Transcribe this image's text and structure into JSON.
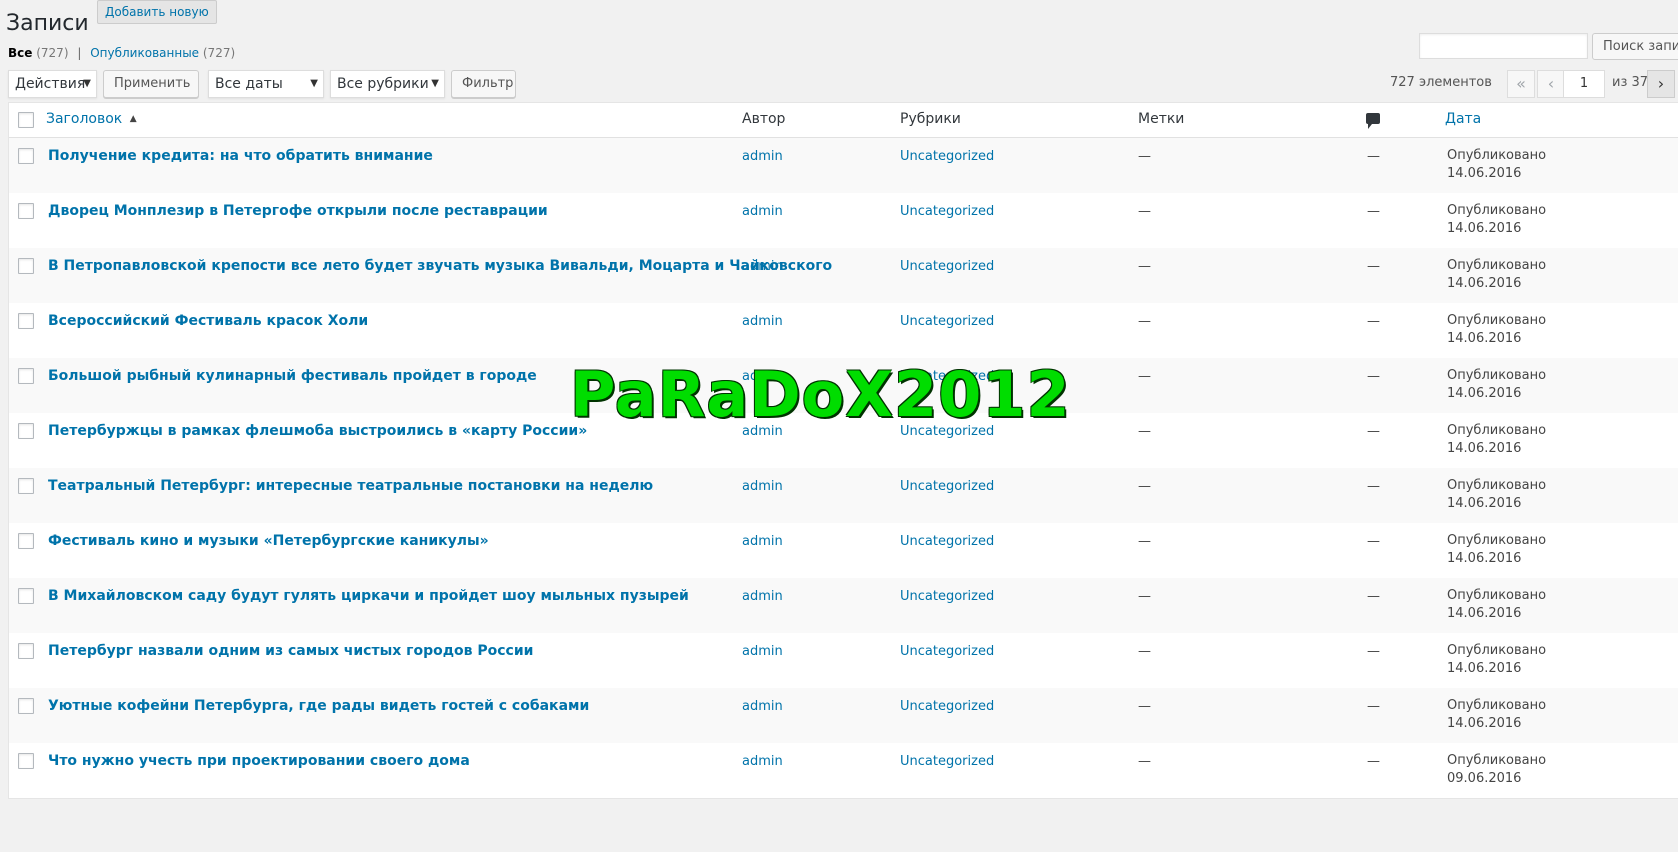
{
  "header": {
    "title": "Записи",
    "add_new": "Добавить новую"
  },
  "views": {
    "all_label": "Все",
    "all_count": "(727)",
    "separator": "|",
    "published_label": "Опубликованные",
    "published_count": "(727)"
  },
  "search": {
    "value": "",
    "button": "Поиск записей"
  },
  "toolbar": {
    "bulk_actions": "Действия",
    "apply": "Применить",
    "dates": "Все даты",
    "categories": "Все рубрики",
    "filter": "Фильтр"
  },
  "pagination": {
    "items": "727 элементов",
    "first": "«",
    "prev": "‹",
    "current": "1",
    "total": "из 37",
    "next": "›"
  },
  "columns": {
    "title": "Заголовок",
    "sort_arrow": "▲",
    "author": "Автор",
    "categories": "Рубрики",
    "tags": "Метки",
    "comments_icon": "comment-bubble-icon",
    "date": "Дата"
  },
  "posts": [
    {
      "title": "Получение кредита: на что обратить внимание",
      "author": "admin",
      "category": "Uncategorized",
      "tags": "—",
      "comments": "—",
      "status": "Опубликовано",
      "date": "14.06.2016"
    },
    {
      "title": "Дворец Монплезир в Петергофе открыли после реставрации",
      "author": "admin",
      "category": "Uncategorized",
      "tags": "—",
      "comments": "—",
      "status": "Опубликовано",
      "date": "14.06.2016"
    },
    {
      "title": "В Петропавловской крепости все лето будет звучать музыка Вивальди, Моцарта и Чайковского",
      "author": "admin",
      "category": "Uncategorized",
      "tags": "—",
      "comments": "—",
      "status": "Опубликовано",
      "date": "14.06.2016"
    },
    {
      "title": "Всероссийский Фестиваль красок Холи",
      "author": "admin",
      "category": "Uncategorized",
      "tags": "—",
      "comments": "—",
      "status": "Опубликовано",
      "date": "14.06.2016"
    },
    {
      "title": "Большой рыбный кулинарный фестиваль пройдет в городе",
      "author": "admin",
      "category": "Uncategorized",
      "tags": "—",
      "comments": "—",
      "status": "Опубликовано",
      "date": "14.06.2016"
    },
    {
      "title": "Петербуржцы в рамках флешмоба выстроились в «карту России»",
      "author": "admin",
      "category": "Uncategorized",
      "tags": "—",
      "comments": "—",
      "status": "Опубликовано",
      "date": "14.06.2016"
    },
    {
      "title": "Театральный Петербург: интересные театральные постановки на неделю",
      "author": "admin",
      "category": "Uncategorized",
      "tags": "—",
      "comments": "—",
      "status": "Опубликовано",
      "date": "14.06.2016"
    },
    {
      "title": "Фестиваль кино и музыки «Петербургские каникулы»",
      "author": "admin",
      "category": "Uncategorized",
      "tags": "—",
      "comments": "—",
      "status": "Опубликовано",
      "date": "14.06.2016"
    },
    {
      "title": "В Михайловском саду будут гулять циркачи и пройдет шоу мыльных пузырей",
      "author": "admin",
      "category": "Uncategorized",
      "tags": "—",
      "comments": "—",
      "status": "Опубликовано",
      "date": "14.06.2016"
    },
    {
      "title": "Петербург назвали одним из самых чистых городов России",
      "author": "admin",
      "category": "Uncategorized",
      "tags": "—",
      "comments": "—",
      "status": "Опубликовано",
      "date": "14.06.2016"
    },
    {
      "title": "Уютные кофейни Петербурга, где рады видеть гостей с собаками",
      "author": "admin",
      "category": "Uncategorized",
      "tags": "—",
      "comments": "—",
      "status": "Опубликовано",
      "date": "14.06.2016"
    },
    {
      "title": "Что нужно учесть при проектировании своего дома",
      "author": "admin",
      "category": "Uncategorized",
      "tags": "—",
      "comments": "—",
      "status": "Опубликовано",
      "date": "09.06.2016"
    }
  ],
  "watermark": "PaRaDoX2012",
  "colors": {
    "link": "#0073aa",
    "watermark": "#00dd00",
    "background": "#f1f1f1"
  }
}
